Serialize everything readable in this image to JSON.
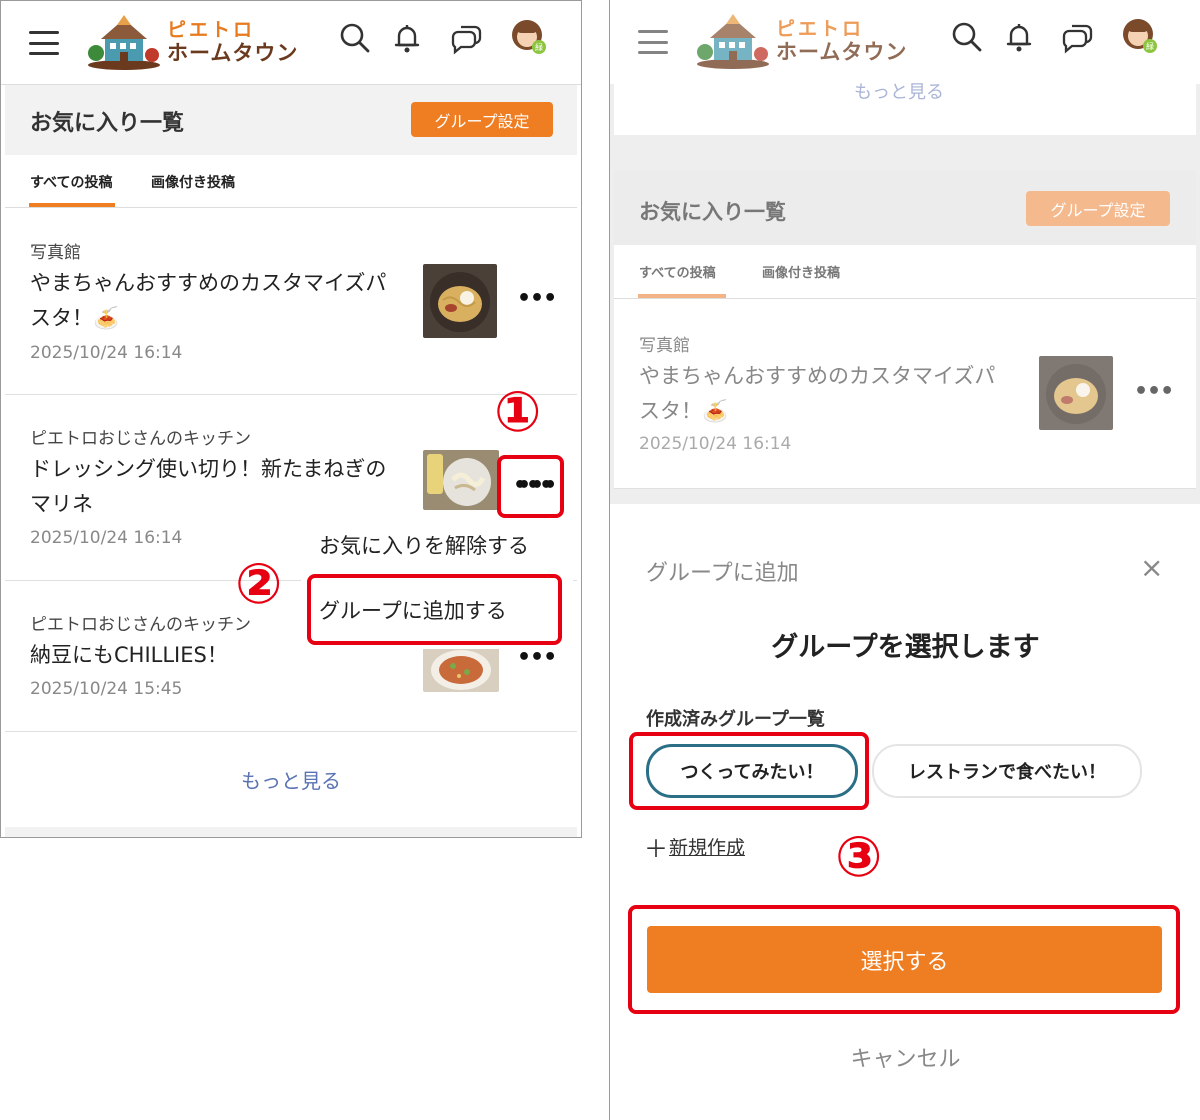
{
  "header": {
    "logo_line1": "ピエトロ",
    "logo_line2": "ホームタウン",
    "icons": [
      "menu-icon",
      "search-icon",
      "bell-icon",
      "chat-icon",
      "avatar"
    ]
  },
  "page": {
    "title": "お気に入り一覧",
    "group_settings": "グループ設定",
    "tabs": [
      "すべての投稿",
      "画像付き投稿"
    ],
    "more_link": "もっと見る"
  },
  "posts": [
    {
      "category": "写真館",
      "title_l1": "やまちゃんおすすめのカスタマイズパ",
      "title_l2": "スタ！🍝",
      "date": "2025/10/24 16:14"
    },
    {
      "category": "ピエトロおじさんのキッチン",
      "title_l1": "ドレッシング使い切り！新たまねぎの",
      "title_l2": "マリネ",
      "date": "2025/10/24 16:14"
    },
    {
      "category": "ピエトロおじさんのキッチン",
      "title_l1": "納豆にもCHILLIES！",
      "title_l2": "",
      "date": "2025/10/24 15:45"
    }
  ],
  "context_menu": {
    "remove_favorite": "お気に入りを解除する",
    "add_to_group": "グループに追加する"
  },
  "steps": [
    "①",
    "②",
    "③"
  ],
  "modal": {
    "header": "グループに追加",
    "close": "×",
    "heading": "グループを選択します",
    "list_label": "作成済みグループ一覧",
    "groups": [
      "つくってみたい！",
      "レストランで食べたい！"
    ],
    "new_plus": "＋",
    "new_label": "新規作成",
    "select": "選択する",
    "cancel": "キャンセル"
  },
  "colors": {
    "accent": "#ef7d22",
    "highlight": "#e60012",
    "link": "#5a73b4",
    "selected_chip": "#2b6f86"
  }
}
